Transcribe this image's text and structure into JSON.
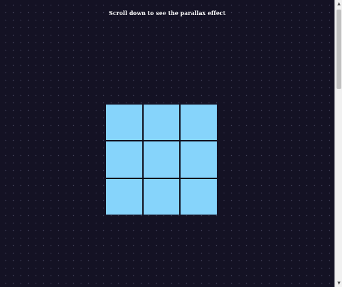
{
  "page": {
    "hint_text": "Scroll down to see the parallax effect"
  },
  "grid": {
    "tile_count": 9,
    "tile_color": "#86d4fb"
  },
  "colors": {
    "background": "#141224",
    "text": "#ffffff"
  },
  "scrollbar": {
    "up_arrow": "▲",
    "down_arrow": "▼",
    "up_icon": "arrow-up-icon",
    "down_icon": "arrow-down-icon"
  }
}
